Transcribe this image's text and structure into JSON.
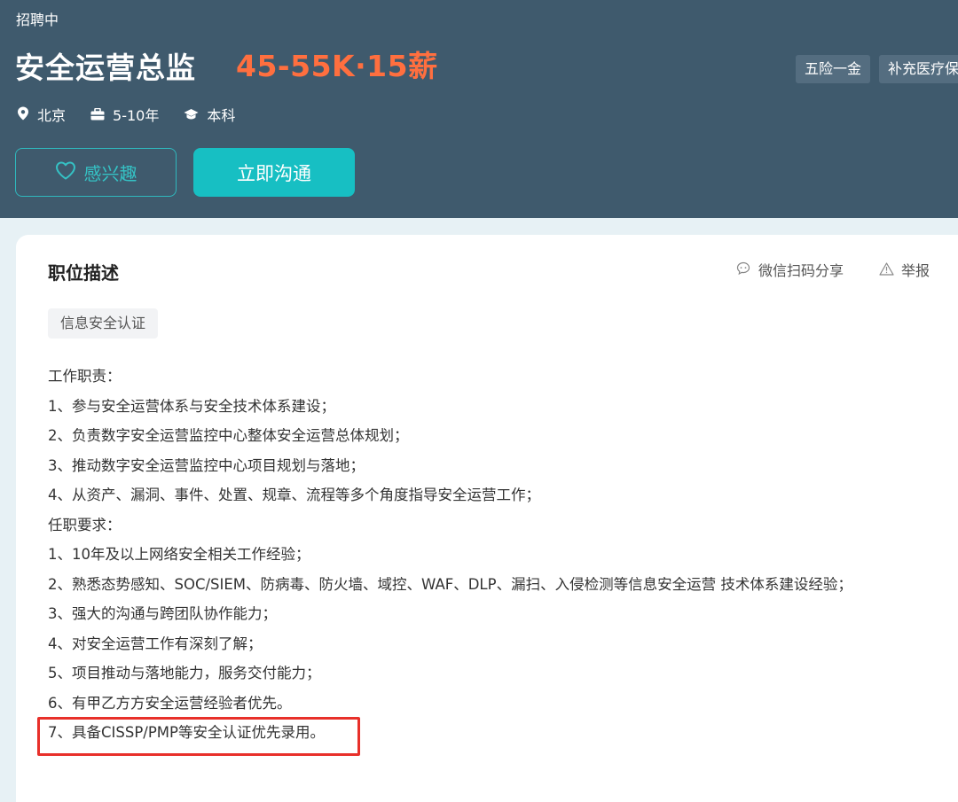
{
  "header": {
    "status": "招聘中",
    "title": "安全运营总监",
    "salary": "45-55K·15薪",
    "benefits": [
      "五险一金",
      "补充医疗保"
    ],
    "meta": {
      "location": "北京",
      "experience": "5-10年",
      "education": "本科"
    },
    "buttons": {
      "interest": "感兴趣",
      "chat": "立即沟通"
    }
  },
  "description": {
    "section_title": "职位描述",
    "share_label": "微信扫码分享",
    "report_label": "举报",
    "skill_tag": "信息安全认证",
    "lines": [
      "工作职责：",
      "1、参与安全运营体系与安全技术体系建设；",
      "2、负责数字安全运营监控中心整体安全运营总体规划；",
      "3、推动数字安全运营监控中心项目规划与落地；",
      "4、从资产、漏洞、事件、处置、规章、流程等多个角度指导安全运营工作；",
      "任职要求：",
      "1、10年及以上网络安全相关工作经验；",
      "2、熟悉态势感知、SOC/SIEM、防病毒、防火墙、域控、WAF、DLP、漏扫、入侵检测等信息安全运营 技术体系建设经验；",
      "3、强大的沟通与跨团队协作能力；",
      "4、对安全运营工作有深刻了解；",
      "5、项目推动与落地能力，服务交付能力；",
      "6、有甲乙方方安全运营经验者优先。",
      "7、具备CISSP/PMP等安全认证优先录用。"
    ]
  },
  "colors": {
    "header_bg": "#3f5a6d",
    "salary": "#ff6f3f",
    "accent": "#17bfc3",
    "highlight": "#e8302a"
  }
}
